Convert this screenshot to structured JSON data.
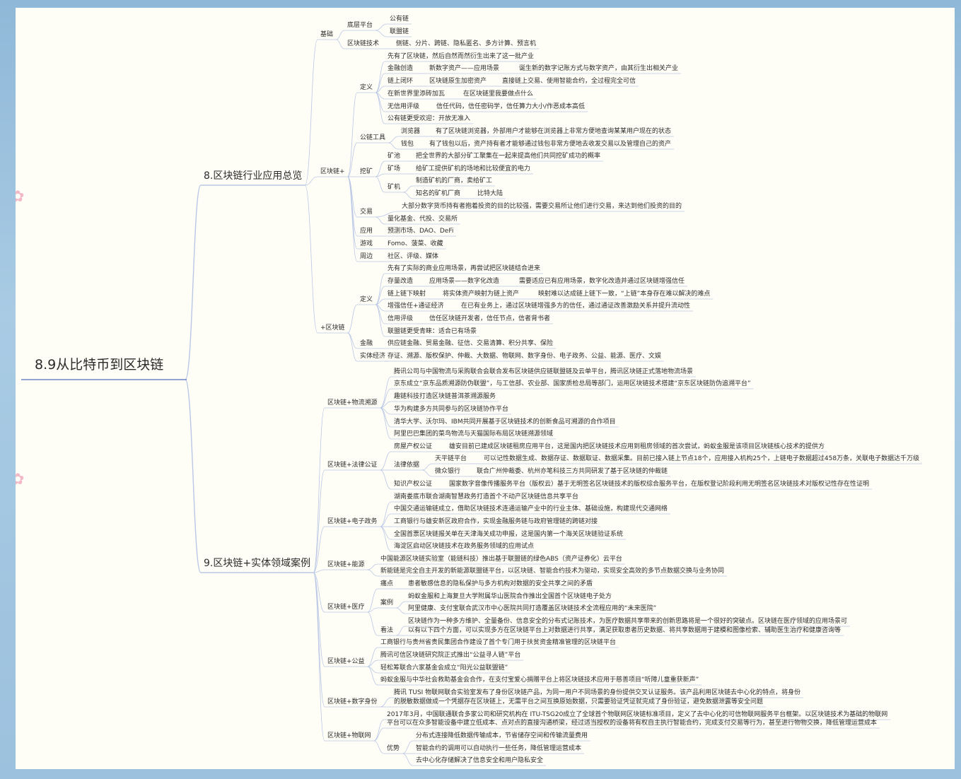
{
  "mindmap": {
    "root": "8.9从比特币到区块链",
    "nodes": [
      {
        "t": "8.区块链行业应用总览",
        "d": 1,
        "p": -1
      },
      {
        "t": "基础",
        "d": 2,
        "p": 0
      },
      {
        "t": "底层平台",
        "d": 3,
        "p": 1
      },
      {
        "t": "公有链",
        "d": 4,
        "p": 2
      },
      {
        "t": "联盟链",
        "d": 4,
        "p": 2
      },
      {
        "t": "区块链技术",
        "d": 3,
        "p": 1
      },
      {
        "t": "侧链、分片、跨链、隐私匿名、多方计算、预言机",
        "d": 4,
        "p": 5
      },
      {
        "t": "区块链+",
        "d": 2,
        "p": 0
      },
      {
        "t": "定义",
        "d": 3,
        "p": 7
      },
      {
        "t": "先有了区块链，然后自然而然衍生出来了这一批产业",
        "d": 4,
        "p": 8
      },
      {
        "t": "金融创造",
        "d": 4,
        "p": 8
      },
      {
        "t": "新数字资产——应用场景",
        "d": 5,
        "p": 10
      },
      {
        "t": "诞生新的数字记账方式与数字资产，由其衍生出相关产业",
        "d": 6,
        "p": 11
      },
      {
        "t": "链上闭环",
        "d": 4,
        "p": 8
      },
      {
        "t": "区块链原生加密资产",
        "d": 5,
        "p": 13
      },
      {
        "t": "直接链上交易、使用智能合约，全过程完全可信",
        "d": 6,
        "p": 14
      },
      {
        "t": "在新世界里添砖加瓦",
        "d": 4,
        "p": 8
      },
      {
        "t": "在区块链里我要做点什么",
        "d": 5,
        "p": 16
      },
      {
        "t": "无信用评级",
        "d": 4,
        "p": 8
      },
      {
        "t": "信任代码，信任密码学，信任算力大小/作恶成本高低",
        "d": 5,
        "p": 18
      },
      {
        "t": "公有链更受欢迎：开放无准入",
        "d": 4,
        "p": 8
      },
      {
        "t": "公链工具",
        "d": 3,
        "p": 7
      },
      {
        "t": "浏览器",
        "d": 4,
        "p": 21
      },
      {
        "t": "有了区块链浏览器，外部用户才能够在浏览器上非常方便地查询某某用户现在的状态",
        "d": 5,
        "p": 22
      },
      {
        "t": "钱包",
        "d": 4,
        "p": 21
      },
      {
        "t": "有了钱包以后，资产持有者才能够通过钱包非常方便地去收发交易以及管理自己的资产",
        "d": 5,
        "p": 24
      },
      {
        "t": "挖矿",
        "d": 3,
        "p": 7
      },
      {
        "t": "矿池",
        "d": 4,
        "p": 26
      },
      {
        "t": "把全世界的大部分矿工聚集在一起来提高他们共同挖矿成功的概率",
        "d": 5,
        "p": 27
      },
      {
        "t": "矿场",
        "d": 4,
        "p": 26
      },
      {
        "t": "给矿工提供矿机的场地和比较便宜的电力",
        "d": 5,
        "p": 29
      },
      {
        "t": "矿机",
        "d": 4,
        "p": 26
      },
      {
        "t": "制造矿机的厂商，卖给矿工",
        "d": 5,
        "p": 31
      },
      {
        "t": "知名的矿机厂商",
        "d": 5,
        "p": 31
      },
      {
        "t": "比特大陆",
        "d": 6,
        "p": 33
      },
      {
        "t": "交易",
        "d": 3,
        "p": 7
      },
      {
        "t": "大部分数字货币持有者抱着投资的目的比较强，需要交易所让他们进行交易，来达到他们投资的目的",
        "d": 4,
        "p": 35
      },
      {
        "t": "量化基金、代投、交易所",
        "d": 4,
        "p": 35
      },
      {
        "t": "应用",
        "d": 3,
        "p": 7
      },
      {
        "t": "预测市场、DAO、DeFi",
        "d": 4,
        "p": 38
      },
      {
        "t": "游戏",
        "d": 3,
        "p": 7
      },
      {
        "t": "Fomo、菠菜、收藏",
        "d": 4,
        "p": 40
      },
      {
        "t": "周边",
        "d": 3,
        "p": 7
      },
      {
        "t": "社区、评级、媒体",
        "d": 4,
        "p": 42
      },
      {
        "t": "+区块链",
        "d": 2,
        "p": 0
      },
      {
        "t": "定义",
        "d": 3,
        "p": 44
      },
      {
        "t": "先有了实际的商业应用场景，再尝试把区块链结合进来",
        "d": 4,
        "p": 45
      },
      {
        "t": "存量改造",
        "d": 4,
        "p": 45
      },
      {
        "t": "应用场景——数字化改造",
        "d": 5,
        "p": 47
      },
      {
        "t": "需要适应已有应用场景，数字化改造并通过区块链增强信任",
        "d": 6,
        "p": 48
      },
      {
        "t": "链上链下映射",
        "d": 4,
        "p": 45
      },
      {
        "t": "将实体资产映射为链上资产",
        "d": 5,
        "p": 50
      },
      {
        "t": "映射难以达成链上链下一致，“上链”本身存在难以解决的难点",
        "d": 6,
        "p": 51
      },
      {
        "t": "增强信任+通证经济",
        "d": 4,
        "p": 45
      },
      {
        "t": "在已有业务上，通过区块链增强多方的信任，通过通证改善激励关系并提升流动性",
        "d": 5,
        "p": 53
      },
      {
        "t": "信用评级",
        "d": 4,
        "p": 45
      },
      {
        "t": "信任区块链开发者，信任节点，信者背书者",
        "d": 5,
        "p": 55
      },
      {
        "t": "联盟链更受青睐：适合已有场景",
        "d": 4,
        "p": 45
      },
      {
        "t": "金融",
        "d": 3,
        "p": 44
      },
      {
        "t": "供应链金融、贸易金融、征信、交易清算、积分共享、保险",
        "d": 4,
        "p": 58
      },
      {
        "t": "实体经济",
        "d": 3,
        "p": 44
      },
      {
        "t": "存证、溯源、版权保护、仲裁、大数据、物联网、数字身份、电子政务、公益、能源、医疗、文娱",
        "d": 4,
        "p": 60
      },
      {
        "t": "9.区块链+实体领域案例",
        "d": 1,
        "p": -1
      },
      {
        "t": "区块链+物流溯源",
        "d": 2,
        "p": 62
      },
      {
        "t": "腾讯公司与中国物流与采购联合会联合发布区块链供应链联盟链及云单平台，腾讯区块链正式落地物流场景",
        "d": 3,
        "p": 63
      },
      {
        "t": "京东成立“京东品质溯源防伪联盟”，与工信部、农业部、国家质检总局等部门，运用区块链技术搭建“京东区块链防伪追溯平台”",
        "d": 3,
        "p": 63
      },
      {
        "t": "趣链科技打造区块链普洱茶溯源服务",
        "d": 3,
        "p": 63
      },
      {
        "t": "华为构建多方共同参与的区块链协作平台",
        "d": 3,
        "p": 63
      },
      {
        "t": "清华大学、沃尔玛、IBM共同开展基于区块链技术的创新食品可溯源的合作项目",
        "d": 3,
        "p": 63
      },
      {
        "t": "阿里巴巴集团的菜鸟物流与天猫国际布局区块链溯源领域",
        "d": 3,
        "p": 63
      },
      {
        "t": "区块链+法律公证",
        "d": 2,
        "p": 62
      },
      {
        "t": "房屋产权公证",
        "d": 3,
        "p": 70
      },
      {
        "t": "雄安目前已建成区块链租房应用平台，这是国内把区块链技术应用到租房领域的首次尝试，蚂蚁金服是该项目区块链核心技术的提供方",
        "d": 4,
        "p": 71
      },
      {
        "t": "法律依据",
        "d": 3,
        "p": 70
      },
      {
        "t": "天平链平台",
        "d": 4,
        "p": 73
      },
      {
        "t": "可以记性数据生成、数据存证、数据取证、数据采集。目前已接入链上节点18个，应用接入机构25个，上链电子数据超过458万条，关联电子数据达千万级",
        "d": 5,
        "p": 74
      },
      {
        "t": "微众银行",
        "d": 4,
        "p": 73
      },
      {
        "t": "联合广州仲裁委、杭州亦笔科技三方共同研发了基于区块链的仲裁链",
        "d": 5,
        "p": 76
      },
      {
        "t": "知识产权公证",
        "d": 3,
        "p": 70
      },
      {
        "t": "国家数字音像传播服务平台（版权云）基于无明签名区块链技术的版权综合服务平台，在版权登记阶段利用无明签名区块链技术对版权记性存在性证明",
        "d": 4,
        "p": 78
      },
      {
        "t": "区块链+电子政务",
        "d": 2,
        "p": 62
      },
      {
        "t": "湖南娄底市联合湖南智慧政务打造首个不动产区块链信息共享平台",
        "d": 3,
        "p": 80
      },
      {
        "t": "中国交通运输链成立，借助区块链技术连通运输产业中的行业主体、基础设施，构建现代交通网络",
        "d": 3,
        "p": 80
      },
      {
        "t": "工商银行与雄安新区政府合作，实现金融服务链与政府管理链的跨链对接",
        "d": 3,
        "p": 80
      },
      {
        "t": "全国首票区块链报关单在天津海关成功申报，这是国内第一个海关区块链验证系统",
        "d": 3,
        "p": 80
      },
      {
        "t": "海淀区启动区块链技术在政务服务领域的应用试点",
        "d": 3,
        "p": 80
      },
      {
        "t": "区块链+能源",
        "d": 2,
        "p": 62
      },
      {
        "t": "中国能源区块链实验室（能链科技）推出基于联盟链的绿色ABS（资产证券化）云平台",
        "d": 3,
        "p": 86
      },
      {
        "t": "新能链是完全自主开发的新能源联盟链平台，以区块链、智能合约技术为驱动，实现安全高效的多节点数据交换与业务协同",
        "d": 3,
        "p": 86
      },
      {
        "t": "区块链+医疗",
        "d": 2,
        "p": 62
      },
      {
        "t": "痛点",
        "d": 3,
        "p": 89
      },
      {
        "t": "患者敏感信息的隐私保护与多方机构对数据的安全共享之间的矛盾",
        "d": 4,
        "p": 90
      },
      {
        "t": "案例",
        "d": 3,
        "p": 89
      },
      {
        "t": "蚂蚁金服和上海复旦大学附属华山医院合作推出全国首个区块链电子处方",
        "d": 4,
        "p": 92
      },
      {
        "t": "阿里健康、支付宝联合武汉市中心医院共同打造覆盖区块链技术全流程应用的“未来医院”",
        "d": 4,
        "p": 92
      },
      {
        "t": "看法",
        "d": 3,
        "p": 89
      },
      {
        "t": "区块链作为一种多方维护、全量备份、信息安全的分布式记账技术，为医疗数据共享带来的创新思路将是一个很好的突破点。区块链在医疗领域的应用场景可",
        "d": 4,
        "p": 95
      },
      {
        "t": "以有以下四个方面，可以实现多方在区块链平台上对数据进行共享，满足获取患者历史数据、将共享数据用于建模和图像检索、辅助医生治疗和健康咨询等",
        "d": 4,
        "p": 95
      },
      {
        "t": "区块链+公益",
        "d": 2,
        "p": 62
      },
      {
        "t": "工商银行与贵州省贵民集团合作建设了首个专门用于扶贫资金精准管理的区块链平台",
        "d": 3,
        "p": 98
      },
      {
        "t": "腾讯可信区块链研究院正式推出“公益寻人链”平台",
        "d": 3,
        "p": 98
      },
      {
        "t": "轻松筹联合六家基金会成立“阳光公益联盟链”",
        "d": 3,
        "p": 98
      },
      {
        "t": "蚂蚁金服与中华社会救助基金会合作，在支付宝爱心捐赠平台上将区块链技术应用于慈善项目“听障儿童重获新声”",
        "d": 3,
        "p": 98
      },
      {
        "t": "区块链+数字身份",
        "d": 2,
        "p": 62
      },
      {
        "t": "腾讯 TUSI 物联网联合实验室发布了身份区块链产品，为同一用户不同场景的身份提供交叉认证服务。该产品利用区块链去中心化的特点，将身份",
        "d": 3,
        "p": 103
      },
      {
        "t": "的脱敏数据做成一个凭据存在区块链上，无需平台之间互换原始数据，只需要验证凭证就完成了身份验证，避免数据泄露等安全问题",
        "d": 3,
        "p": 103
      },
      {
        "t": "区块链+物联网",
        "d": 2,
        "p": 62
      },
      {
        "t": "2017年3月，中国联通联合多家公司和研究机构在 ITU-TSG20成立了全球首个物联网区块链标准项目，定义了去中心化的可信物联网服务平台框架。以区块链技术为基础的物联网",
        "d": 3,
        "p": 106
      },
      {
        "t": "平台可以在众多智能设备中建立低成本、点对点的直接沟通桥梁，经过适当授权的设备将有权自主执行智能合约，完成支付交易等行为，甚至进行物物交换，降低管理运营成本",
        "d": 3,
        "p": 106
      },
      {
        "t": "优势",
        "d": 3,
        "p": 106
      },
      {
        "t": "分布式连接降低数据传输成本，节省储存空间和传输流量费用",
        "d": 4,
        "p": 109
      },
      {
        "t": "智能合约的调用可以自动执行一些任务，降低管理运营成本",
        "d": 4,
        "p": 109
      },
      {
        "t": "去中心化存储解决了信息安全和用户隐私安全",
        "d": 4,
        "p": 109
      }
    ]
  },
  "colors": {
    "line": "#b9c7e6",
    "text": "#2c2c2c",
    "root_line": "#6f86c7",
    "bg": "#fffef6"
  }
}
